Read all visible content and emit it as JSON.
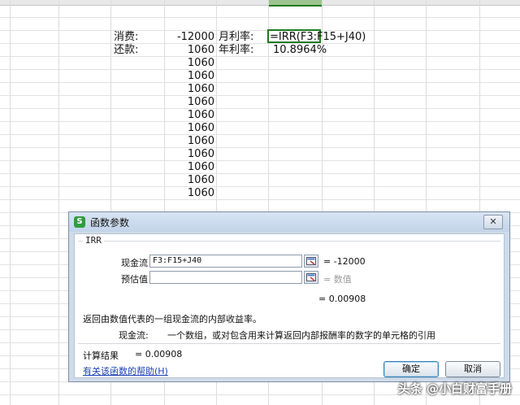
{
  "sheet": {
    "label_cost": "消费:",
    "value_cost": "-12000",
    "label_repay": "还款:",
    "repayments": [
      "1060",
      "1060",
      "1060",
      "1060",
      "1060",
      "1060",
      "1060",
      "1060",
      "1060",
      "1060",
      "1060",
      "1060"
    ],
    "label_monthly": "月利率:",
    "formula": "=IRR(F3:F15+J40)",
    "label_annual": "年利率:",
    "annual_value": "10.8964%"
  },
  "dialog": {
    "title": "函数参数",
    "app_icon_letter": "S",
    "close_label": "✕",
    "function_name": "IRR",
    "args": [
      {
        "label": "现金流",
        "value": "F3:F15+J40",
        "result": "= -12000"
      },
      {
        "label": "预估值",
        "value": "",
        "result": "= 数值"
      }
    ],
    "function_result": "= 0.00908",
    "description": "返回由数值代表的一组现金流的内部收益率。",
    "param_label": "现金流:",
    "param_description": "一个数组，或对包含用来计算返回内部报酬率的数字的单元格的引用",
    "calc_label": "计算结果",
    "calc_value": "= 0.00908",
    "help_link": "有关该函数的帮助(H)",
    "ok_label": "确定",
    "cancel_label": "取消"
  },
  "watermark": "头条 @小白财富手册",
  "colors": {
    "accent": "#1d7a1d",
    "link": "#1b3fb7",
    "dialog_bg": "#cfdbe9"
  },
  "icons": [
    "app-s-icon",
    "close-icon",
    "range-select-icon"
  ]
}
